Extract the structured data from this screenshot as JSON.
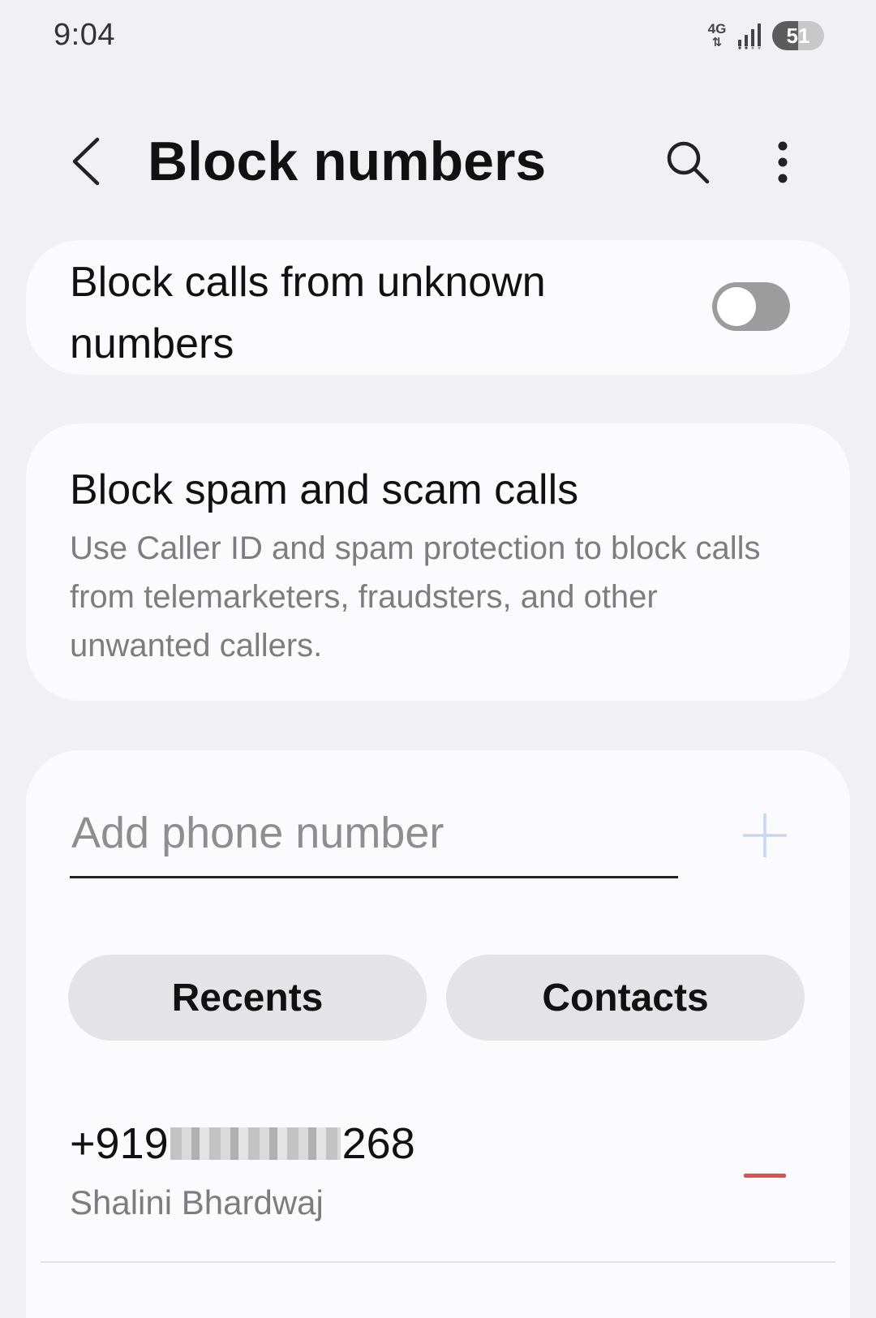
{
  "status_bar": {
    "time": "9:04",
    "network": "4G",
    "battery": "51",
    "icons": [
      "network-4g-icon",
      "signal-icon",
      "battery-icon"
    ]
  },
  "header": {
    "title": "Block numbers",
    "icons": [
      "back-arrow-icon",
      "search-icon",
      "more-vert-icon"
    ]
  },
  "unknown_numbers": {
    "label": "Block calls from unknown numbers",
    "enabled": false
  },
  "spam": {
    "title": "Block spam and scam calls",
    "description": "Use Caller ID and spam protection to block calls from telemarketers, fraudsters, and other unwanted callers."
  },
  "add_number": {
    "placeholder": "Add phone number",
    "value": "",
    "add_icon": "plus-icon"
  },
  "buttons": {
    "recents": "Recents",
    "contacts": "Contacts"
  },
  "blocked_list": [
    {
      "number_prefix": "+919",
      "number_suffix": "268",
      "name": "Shalini Bhardwaj",
      "remove_icon": "remove-icon"
    }
  ],
  "colors": {
    "background": "#f1f1f3",
    "card": "#fbfbfd",
    "toggle_off": "#9c9c9c",
    "pill": "#e4e4e6",
    "remove": "#d9534f",
    "add_icon": "#c9d6f2"
  }
}
